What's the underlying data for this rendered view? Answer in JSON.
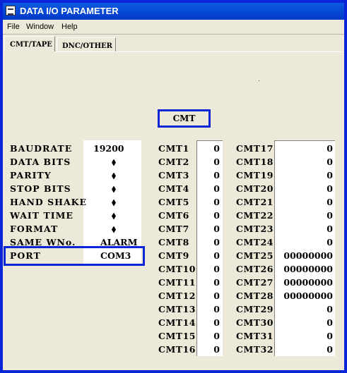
{
  "window": {
    "title": "DATA I/O PARAMETER"
  },
  "menu": {
    "file": "File",
    "window": "Window",
    "help": "Help"
  },
  "tabs": {
    "active": "CMT/TAPE",
    "inactive": "DNC/OTHER"
  },
  "section_header": "CMT",
  "params": {
    "baudrate": {
      "label": "BAUDRATE",
      "value": "19200"
    },
    "data_bits": {
      "label": "DATA BITS"
    },
    "parity": {
      "label": "PARITY"
    },
    "stop_bits": {
      "label": "STOP BITS"
    },
    "hand_shake": {
      "label": "HAND SHAKE"
    },
    "wait_time": {
      "label": "WAIT TIME"
    },
    "format": {
      "label": "FORMAT"
    },
    "same_wno": {
      "label": "SAME WNo.",
      "value": "ALARM"
    },
    "port": {
      "label": "PORT",
      "value": "COM3"
    }
  },
  "cmt_left": [
    {
      "label": "CMT1",
      "value": "0"
    },
    {
      "label": "CMT2",
      "value": "0"
    },
    {
      "label": "CMT3",
      "value": "0"
    },
    {
      "label": "CMT4",
      "value": "0"
    },
    {
      "label": "CMT5",
      "value": "0"
    },
    {
      "label": "CMT6",
      "value": "0"
    },
    {
      "label": "CMT7",
      "value": "0"
    },
    {
      "label": "CMT8",
      "value": "0"
    },
    {
      "label": "CMT9",
      "value": "0"
    },
    {
      "label": "CMT10",
      "value": "0"
    },
    {
      "label": "CMT11",
      "value": "0"
    },
    {
      "label": "CMT12",
      "value": "0"
    },
    {
      "label": "CMT13",
      "value": "0"
    },
    {
      "label": "CMT14",
      "value": "0"
    },
    {
      "label": "CMT15",
      "value": "0"
    },
    {
      "label": "CMT16",
      "value": "0"
    }
  ],
  "cmt_right": [
    {
      "label": "CMT17",
      "value": "0"
    },
    {
      "label": "CMT18",
      "value": "0"
    },
    {
      "label": "CMT19",
      "value": "0"
    },
    {
      "label": "CMT20",
      "value": "0"
    },
    {
      "label": "CMT21",
      "value": "0"
    },
    {
      "label": "CMT22",
      "value": "0"
    },
    {
      "label": "CMT23",
      "value": "0"
    },
    {
      "label": "CMT24",
      "value": "0"
    },
    {
      "label": "CMT25",
      "value": "00000000"
    },
    {
      "label": "CMT26",
      "value": "00000000"
    },
    {
      "label": "CMT27",
      "value": "00000000"
    },
    {
      "label": "CMT28",
      "value": "00000000"
    },
    {
      "label": "CMT29",
      "value": "0"
    },
    {
      "label": "CMT30",
      "value": "0"
    },
    {
      "label": "CMT31",
      "value": "0"
    },
    {
      "label": "CMT32",
      "value": "0"
    }
  ]
}
